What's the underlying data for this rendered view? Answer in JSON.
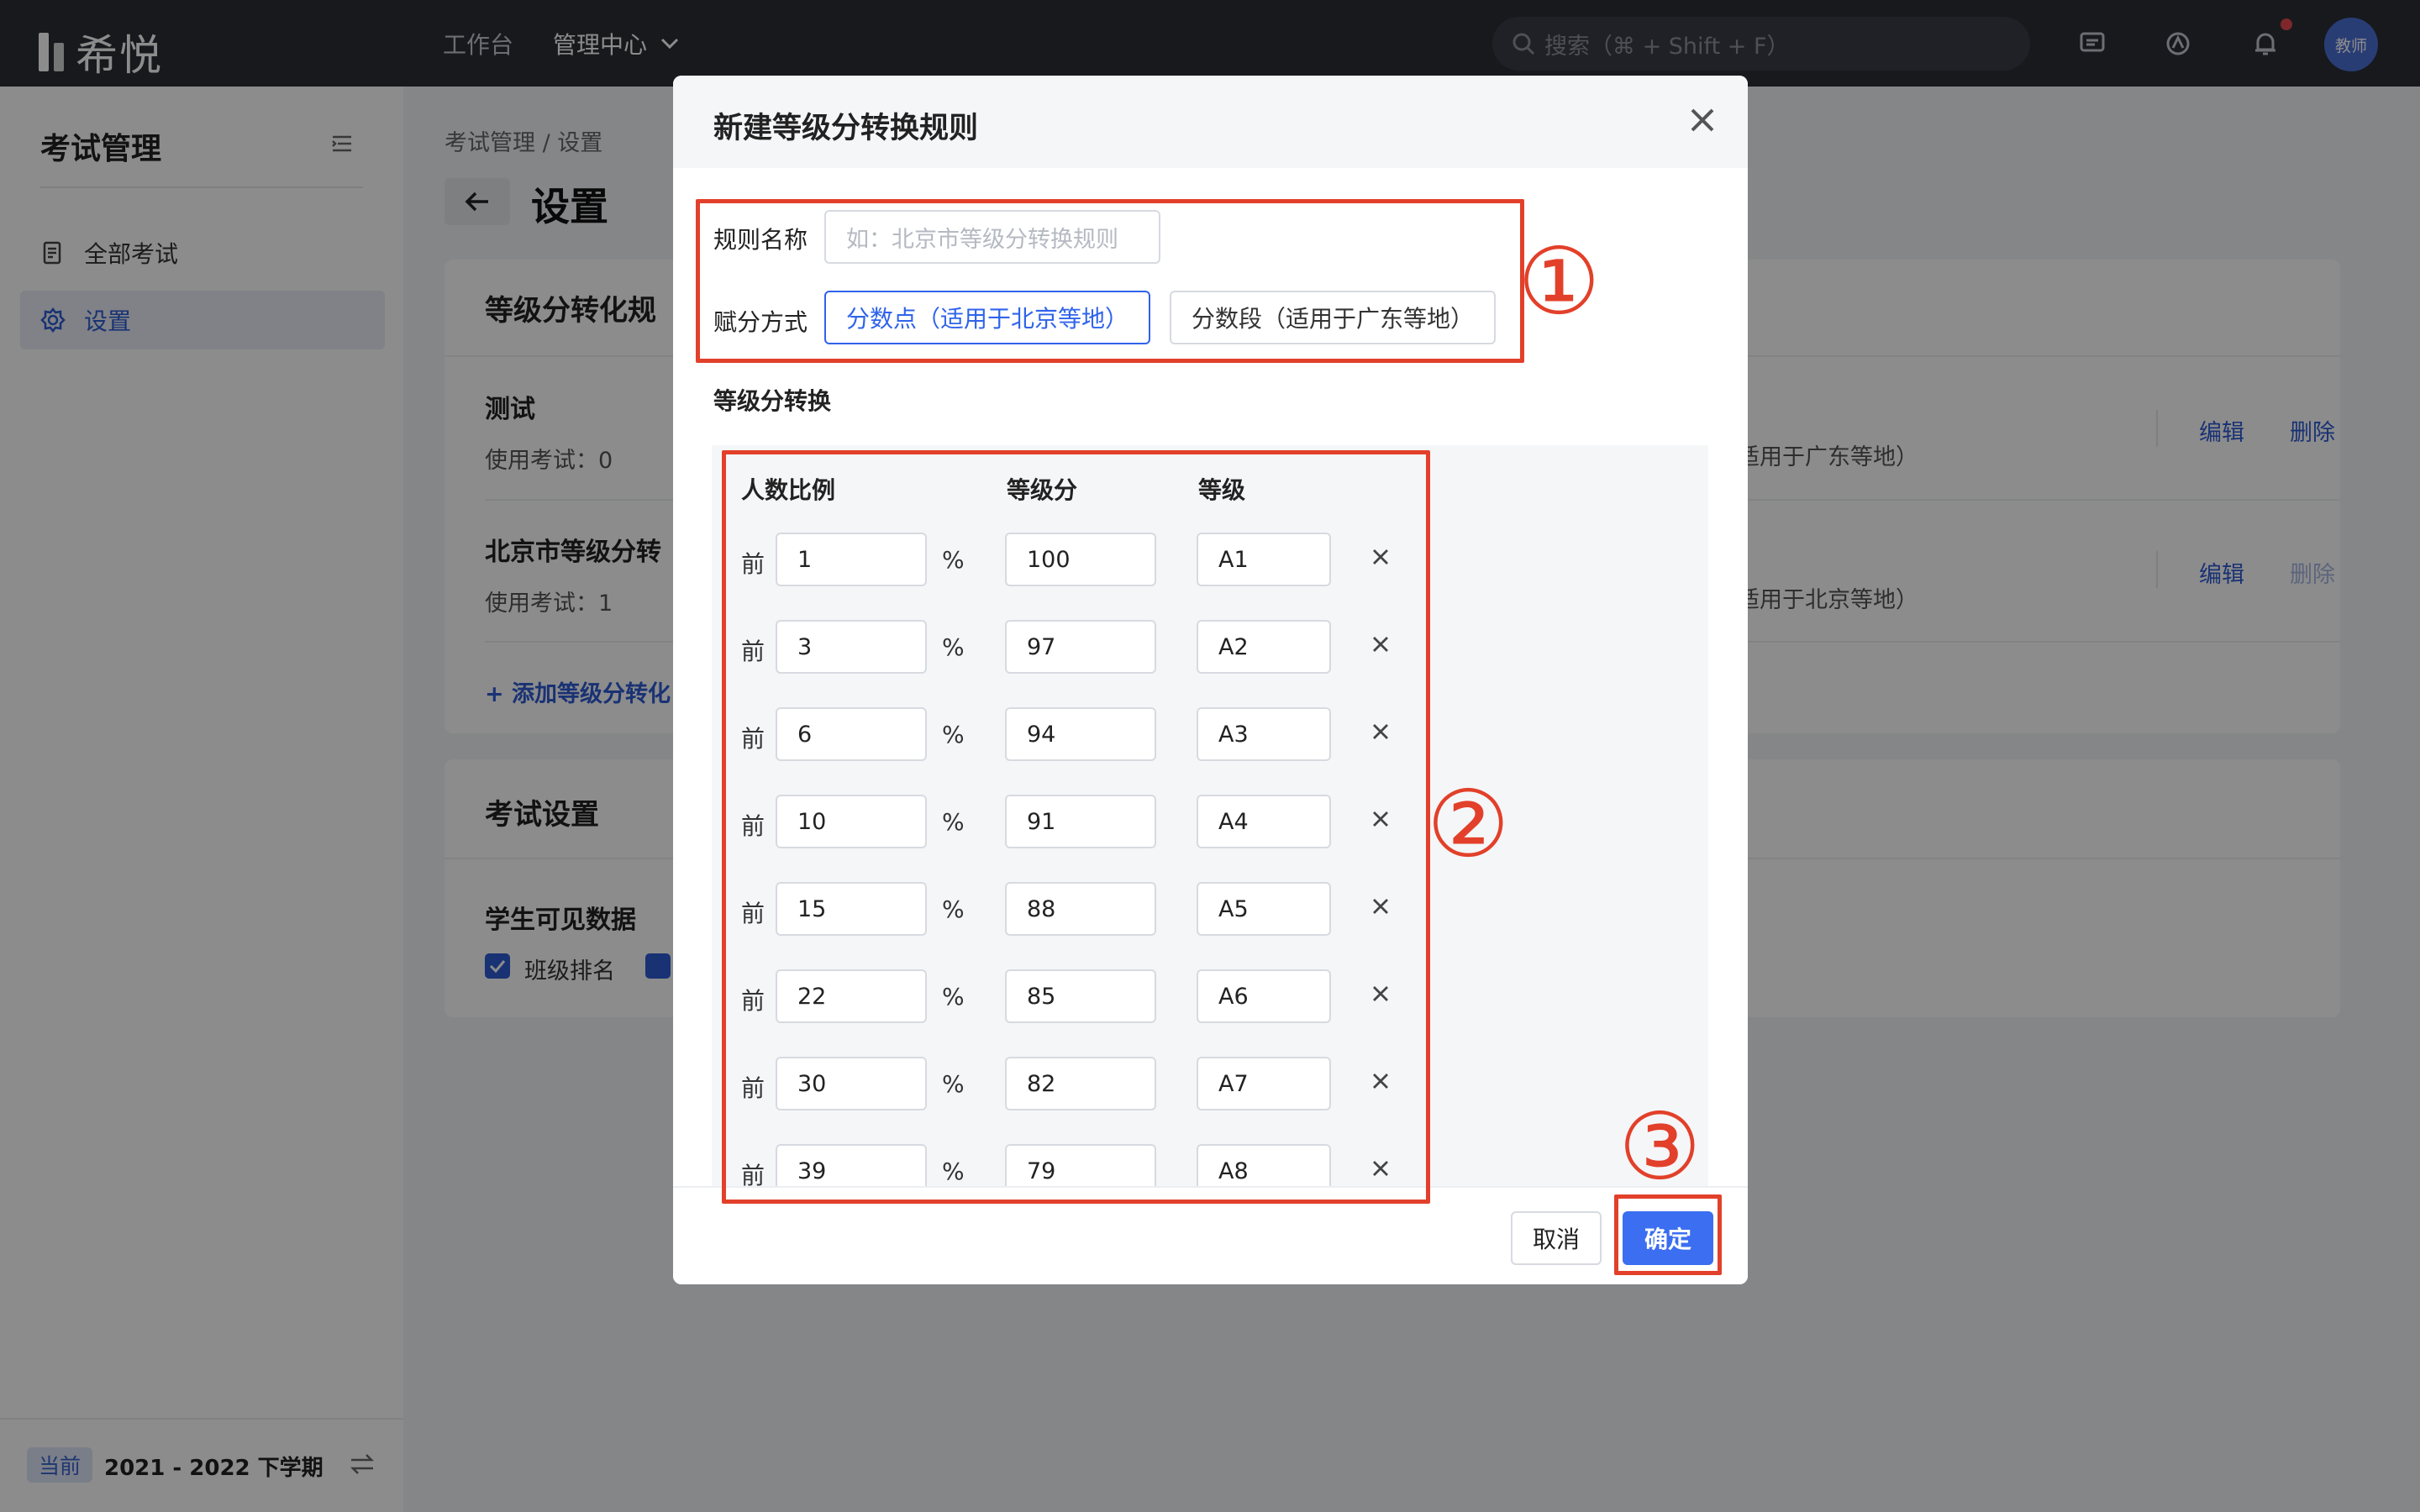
{
  "topbar": {
    "logo_text": "希悦",
    "nav": [
      {
        "label": "工作台",
        "active": false
      },
      {
        "label": "管理中心",
        "active": true
      }
    ],
    "search_placeholder": "搜索（⌘ + Shift + F）",
    "avatar_text": "教师"
  },
  "sidebar": {
    "title": "考试管理",
    "items": [
      {
        "label": "全部考试",
        "icon": "exam-list-icon",
        "active": false
      },
      {
        "label": "设置",
        "icon": "gear-icon",
        "active": true
      }
    ],
    "term_badge": "当前",
    "term_label": "2021 - 2022 下学期"
  },
  "main": {
    "breadcrumb": "考试管理  /  设置",
    "title": "设置",
    "rules_card": {
      "title": "等级分转化规",
      "rules": [
        {
          "name": "测试",
          "usage": "使用考试：0",
          "method": "（适用于广东等地）",
          "edit": "编辑",
          "delete": "删除"
        },
        {
          "name": "北京市等级分转",
          "usage": "使用考试：1",
          "method": "（适用于北京等地）",
          "edit": "编辑",
          "delete": "删除"
        }
      ],
      "add_link": "+ 添加等级分转化"
    },
    "exam_card": {
      "title": "考试设置",
      "section": "学生可见数据",
      "checkbox_label": "班级排名"
    }
  },
  "modal": {
    "title": "新建等级分转换规则",
    "name_label": "规则名称",
    "name_placeholder": "如：北京市等级分转换规则",
    "method_label": "赋分方式",
    "method_options": [
      {
        "label": "分数点（适用于北京等地）",
        "selected": true
      },
      {
        "label": "分数段（适用于广东等地）",
        "selected": false
      }
    ],
    "section_label": "等级分转换",
    "columns": [
      "人数比例",
      "等级分",
      "等级"
    ],
    "row_prefix": "前",
    "row_suffix": "%",
    "rows": [
      {
        "pct": "1",
        "score": "100",
        "grade": "A1"
      },
      {
        "pct": "3",
        "score": "97",
        "grade": "A2"
      },
      {
        "pct": "6",
        "score": "94",
        "grade": "A3"
      },
      {
        "pct": "10",
        "score": "91",
        "grade": "A4"
      },
      {
        "pct": "15",
        "score": "88",
        "grade": "A5"
      },
      {
        "pct": "22",
        "score": "85",
        "grade": "A6"
      },
      {
        "pct": "30",
        "score": "82",
        "grade": "A7"
      },
      {
        "pct": "39",
        "score": "79",
        "grade": "A8"
      }
    ],
    "cancel_label": "取消",
    "ok_label": "确定"
  },
  "annotations": [
    "①",
    "②",
    "③"
  ],
  "colors": {
    "accent": "#2f63ea",
    "annotation": "#e2402a",
    "topbar": "#2b2e36"
  }
}
